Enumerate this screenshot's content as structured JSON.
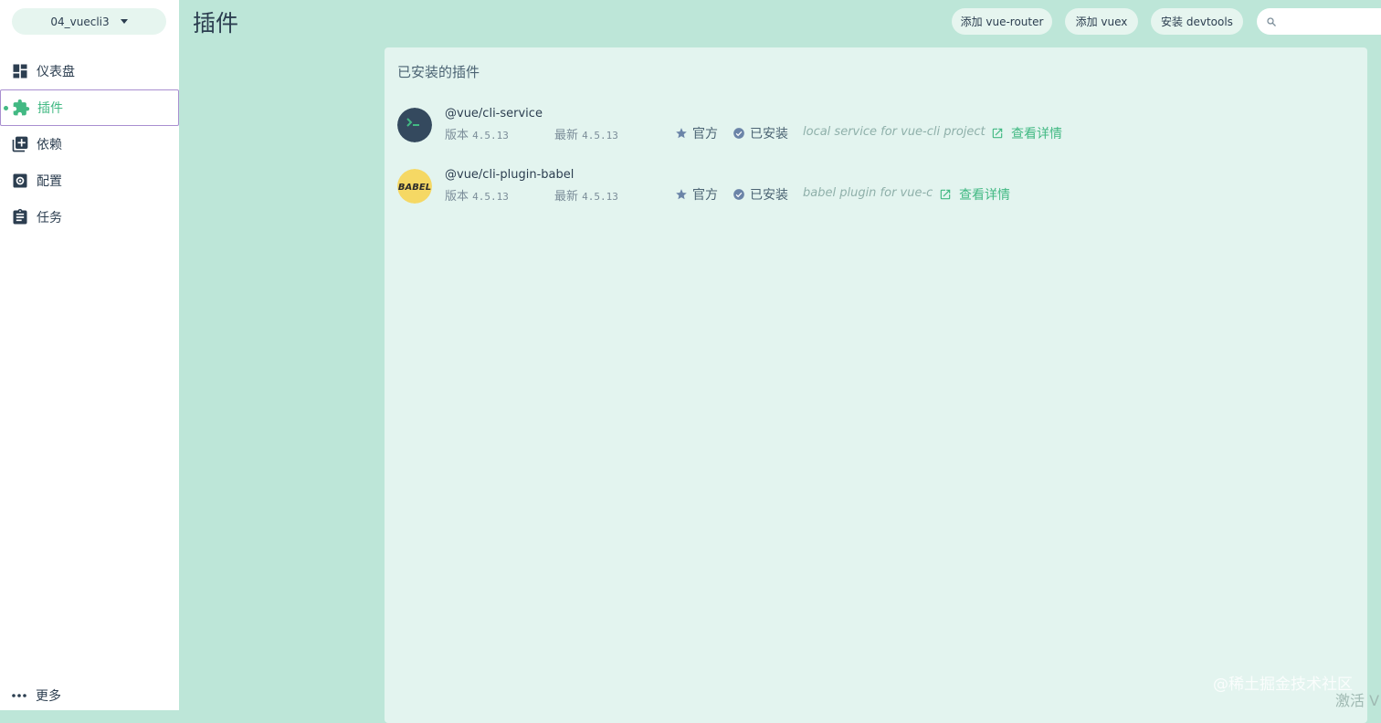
{
  "sidebar": {
    "project_name": "04_vuecli3",
    "nav": [
      {
        "label": "仪表盘",
        "icon": "dashboard-icon"
      },
      {
        "label": "插件",
        "icon": "puzzle-icon"
      },
      {
        "label": "依赖",
        "icon": "library-icon"
      },
      {
        "label": "配置",
        "icon": "settings-icon"
      },
      {
        "label": "任务",
        "icon": "clipboard-icon"
      }
    ],
    "active_index": 1,
    "more_label": "更多"
  },
  "header": {
    "title": "插件",
    "buttons": {
      "add_router": "添加 vue-router",
      "add_vuex": "添加 vuex",
      "install_devtools": "安装 devtools"
    },
    "search": {
      "value": "",
      "placeholder": ""
    }
  },
  "main": {
    "section_title": "已安装的插件",
    "plugins": [
      {
        "name": "@vue/cli-service",
        "version_label": "版本",
        "version": "4.5.13",
        "latest_label": "最新",
        "latest": "4.5.13",
        "official": "官方",
        "installed": "已安装",
        "description": "local service for vue-cli projects",
        "details": "查看详情",
        "logo": "terminal-logo"
      },
      {
        "name": "@vue/cli-plugin-babel",
        "version_label": "版本",
        "version": "4.5.13",
        "latest_label": "最新",
        "latest": "4.5.13",
        "official": "官方",
        "installed": "已安装",
        "description": "babel plugin for vue-cli",
        "details": "查看详情",
        "logo": "babel-logo"
      }
    ]
  },
  "overlay": {
    "watermark": "@稀土掘金技术社区",
    "activate": "激活 V"
  },
  "colors": {
    "accent": "#42b983",
    "background": "#bde6d8",
    "panel": "#e3f4ef",
    "active_border": "#a98fd0"
  }
}
